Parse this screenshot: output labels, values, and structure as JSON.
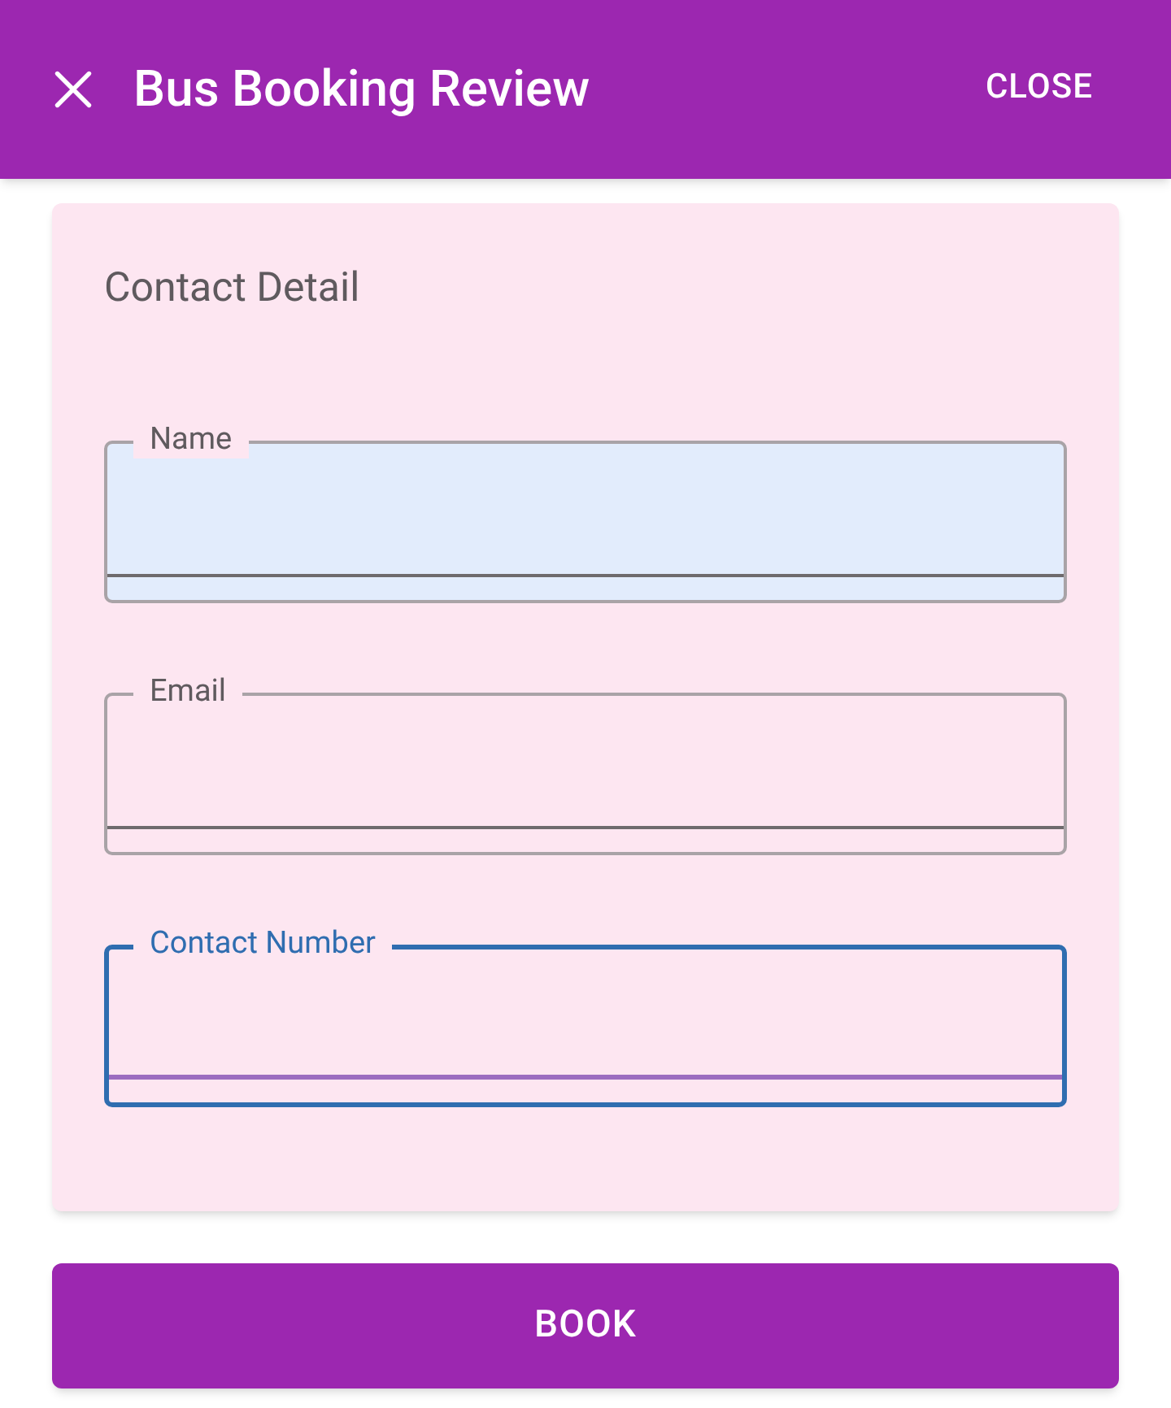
{
  "header": {
    "title": "Bus Booking Review",
    "action": "CLOSE"
  },
  "contact": {
    "title": "Contact Detail",
    "fields": [
      {
        "label": "Name",
        "autofilled": true,
        "focused": false
      },
      {
        "label": "Email",
        "autofilled": false,
        "focused": false
      },
      {
        "label": "Contact Number",
        "autofilled": false,
        "focused": true
      }
    ]
  },
  "button": {
    "label": "BOOK"
  }
}
